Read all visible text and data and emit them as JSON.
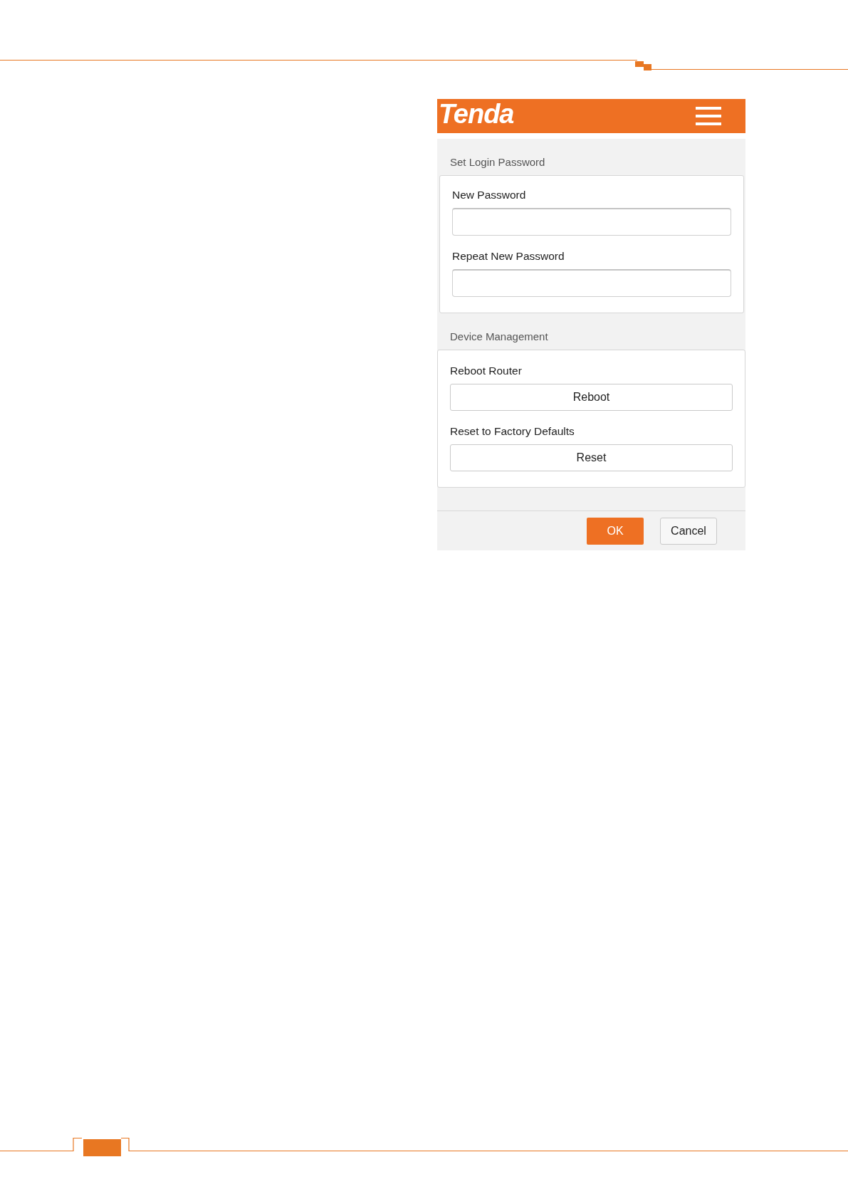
{
  "header": {
    "logo": "Tenda"
  },
  "sections": [
    {
      "title": "Set Login Password",
      "items": [
        {
          "kind": "field",
          "label": "New Password"
        },
        {
          "kind": "field",
          "label": "Repeat New Password"
        }
      ]
    },
    {
      "title": "Device Management",
      "items": [
        {
          "kind": "button",
          "label": "Reboot Router",
          "button": "Reboot"
        },
        {
          "kind": "button",
          "label": "Reset to Factory Defaults",
          "button": "Reset"
        }
      ]
    }
  ],
  "footer": {
    "buttons": [
      {
        "label": "OK",
        "kind": "primary"
      },
      {
        "label": "Cancel",
        "kind": "secondary"
      }
    ]
  }
}
